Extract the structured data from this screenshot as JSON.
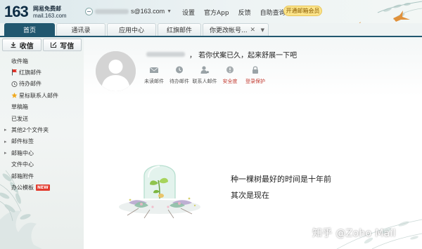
{
  "logo": {
    "number": "163",
    "text": "网易免费邮",
    "url": "mail.163.com"
  },
  "account": {
    "email_suffix": "s@163.com",
    "icon": "account-icon"
  },
  "header": {
    "links": [
      "设置",
      "官方App",
      "反馈",
      "自助查询"
    ],
    "vip_button": "开通邮箱会员"
  },
  "tabs": [
    {
      "label": "首页",
      "active": true
    },
    {
      "label": "通讯录"
    },
    {
      "label": "应用中心"
    },
    {
      "label": "红旗邮件"
    },
    {
      "label": "你更改帐号..."
    }
  ],
  "colors": {
    "accent": "#21576f",
    "vip": "#fbe48a",
    "badge": "#e23b2e"
  },
  "sidebar": {
    "receive_label": "收信",
    "compose_label": "写信",
    "folders": [
      {
        "label": "收件箱",
        "type": "plain"
      },
      {
        "label": "红旗邮件",
        "type": "icon",
        "icon": "red-flag-icon"
      },
      {
        "label": "待办邮件",
        "type": "icon",
        "icon": "clock-icon"
      },
      {
        "label": "星标联系人邮件",
        "type": "icon",
        "icon": "star-icon"
      },
      {
        "label": "草稿箱",
        "type": "plain"
      },
      {
        "label": "已发送",
        "type": "plain"
      },
      {
        "label": "其他2个文件夹",
        "type": "expand"
      },
      {
        "label": "邮件标签",
        "type": "expand"
      },
      {
        "label": "邮箱中心",
        "type": "expand"
      },
      {
        "label": "文件中心",
        "type": "plain"
      },
      {
        "label": "邮箱附件",
        "type": "plain"
      },
      {
        "label": "办公模板",
        "type": "plain",
        "badge": "NEW"
      }
    ]
  },
  "main": {
    "greeting": "， 若你伏案已久，起来舒展一下吧",
    "quicklinks": [
      {
        "label": "未读邮件",
        "icon": "envelope-icon"
      },
      {
        "label": "待办邮件",
        "icon": "clock-icon"
      },
      {
        "label": "联系人邮件",
        "icon": "contact-star-icon"
      },
      {
        "label": "安全度",
        "icon": "security-alert-icon",
        "alert": true
      },
      {
        "label": "登录保护",
        "icon": "lock-icon",
        "alert": true
      }
    ],
    "slogan_line1": "种一棵树最好的时间是十年前",
    "slogan_line2": "其次是现在"
  },
  "watermark": "知乎 @Zoho Mail"
}
